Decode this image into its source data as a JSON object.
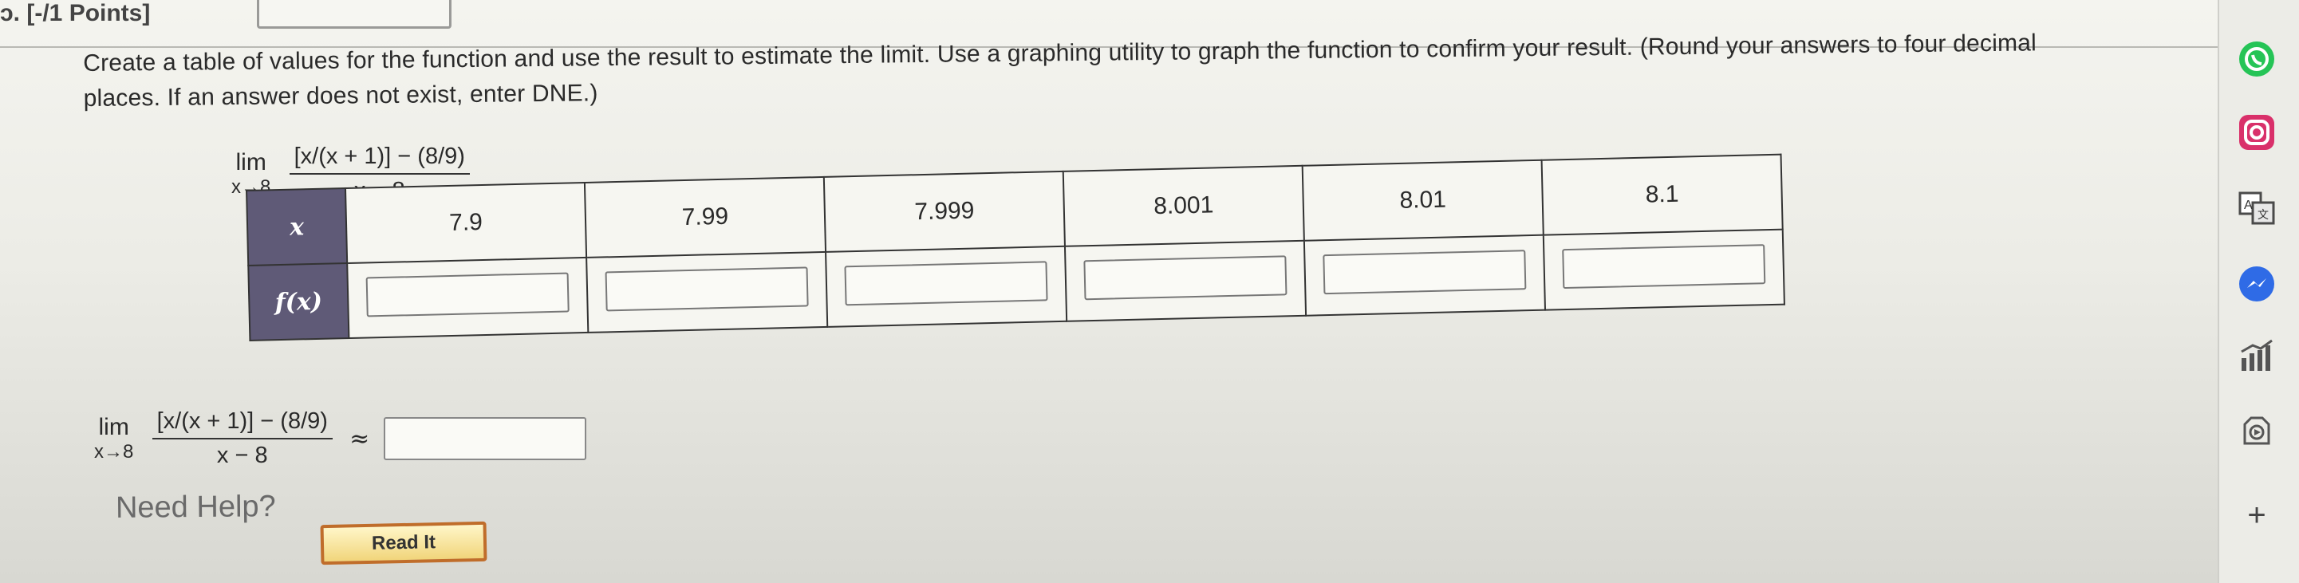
{
  "header": {
    "prev_question_fragment": "ɔ. [-/1 Points]"
  },
  "prompt": "Create a table of values for the function and use the result to estimate the limit. Use a graphing utility to graph the function to confirm your result. (Round your answers to four decimal places. If an answer does not exist, enter DNE.)",
  "limit": {
    "lim_word": "lim",
    "subscript": "x→8",
    "numerator": "[x/(x + 1)] − (8/9)",
    "denominator": "x − 8",
    "approx_symbol": "≈"
  },
  "table": {
    "x_header": "x",
    "fx_header": "f(x)",
    "x_values": [
      "7.9",
      "7.99",
      "7.999",
      "8.001",
      "8.01",
      "8.1"
    ]
  },
  "help": {
    "label": "Need Help?",
    "read_it": "Read It"
  },
  "sidebar": {
    "icons": [
      "whatsapp-icon",
      "instagram-icon",
      "translate-icon",
      "messenger-icon",
      "chart-icon",
      "camera-icon",
      "add-icon"
    ],
    "add_label": "+"
  }
}
